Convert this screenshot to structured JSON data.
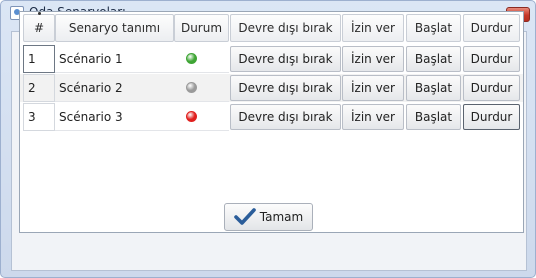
{
  "window": {
    "title": "Oda Senaryoları"
  },
  "table": {
    "columns": [
      "#",
      "Senaryo tanımı",
      "Durum",
      "Devre dışı bırak",
      "İzin ver",
      "Başlat",
      "Durdur"
    ],
    "rows": [
      {
        "num": "1",
        "name": "Scénario 1",
        "status": "green",
        "disable_label": "Devre dışı bırak",
        "allow_label": "İzin ver",
        "start_label": "Başlat",
        "stop_label": "Durdur"
      },
      {
        "num": "2",
        "name": "Scénario 2",
        "status": "gray",
        "disable_label": "Devre dışı bırak",
        "allow_label": "İzin ver",
        "start_label": "Başlat",
        "stop_label": "Durdur"
      },
      {
        "num": "3",
        "name": "Scénario 3",
        "status": "red",
        "disable_label": "Devre dışı bırak",
        "allow_label": "İzin ver",
        "start_label": "Başlat",
        "stop_label": "Durdur"
      }
    ]
  },
  "status_colors": {
    "green": "#3fa535",
    "gray": "#9a9a9a",
    "red": "#e0201e"
  },
  "footer": {
    "ok_label": "Tamam",
    "ok_icon": "checkmark-icon",
    "ok_icon_color": "#2b5d9a"
  },
  "icons": {
    "window_icon": "window-icon",
    "close_icon": "close-icon"
  }
}
